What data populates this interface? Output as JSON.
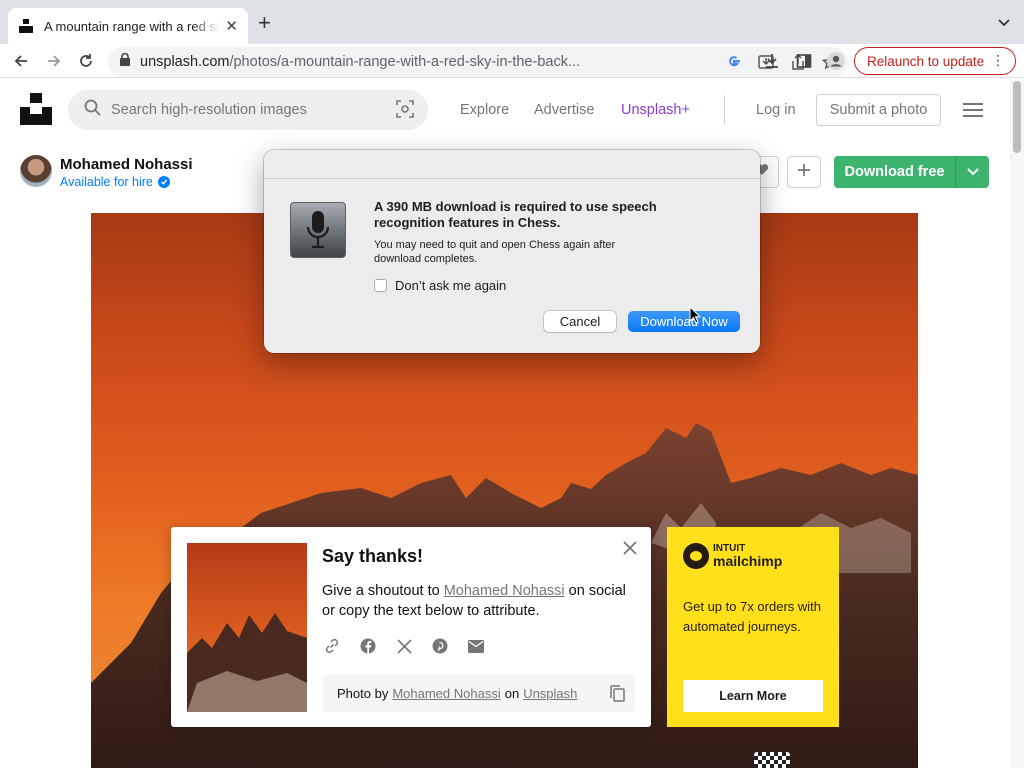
{
  "browser": {
    "tab_title": "A mountain range with a red sky in the back",
    "url_domain": "unsplash.com",
    "url_path": "/photos/a-mountain-range-with-a-red-sky-in-the-back...",
    "relaunch_label": "Relaunch to update",
    "relaunch_color": "#c5221f"
  },
  "header": {
    "search_placeholder": "Search high-resolution images",
    "nav": {
      "explore": "Explore",
      "advertise": "Advertise",
      "unsplash_plus": "Unsplash+"
    },
    "login": "Log in",
    "submit": "Submit a photo"
  },
  "author": {
    "name": "Mohamed Nohassi",
    "status": "Available for hire"
  },
  "actions": {
    "download_label": "Download free",
    "download_color": "#3cb46e"
  },
  "dialog": {
    "heading": "A 390 MB download is required to use speech recognition features in Chess.",
    "body": "You may need to quit and open Chess again after download completes.",
    "checkbox_label": "Don’t ask me again",
    "cancel": "Cancel",
    "confirm": "Download Now",
    "accent": "#0b78f5"
  },
  "thanks": {
    "title": "Say thanks!",
    "text_before": "Give a shoutout to",
    "author_link": "Mohamed Nohassi",
    "text_after": "on social or copy the text below to attribute.",
    "attribution_prefix": "Photo by",
    "attribution_author": "Mohamed Nohassi",
    "attribution_on": "on",
    "attribution_site": "Unsplash"
  },
  "ad": {
    "brand_top": "INTUIT",
    "brand_bottom": "mailchimp",
    "copy": "Get up to 7x orders with automated journeys.",
    "button": "Learn More",
    "color": "#ffe01b"
  }
}
